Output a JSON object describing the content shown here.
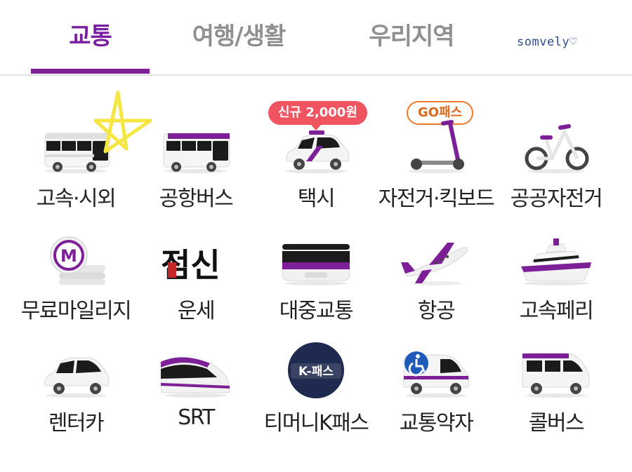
{
  "tabs": [
    {
      "label": "교통",
      "active": true
    },
    {
      "label": "여행/생활",
      "active": false
    },
    {
      "label": "우리지역",
      "active": false
    }
  ],
  "brand_text": "somvely♡",
  "accent_color": "#7b1fa2",
  "items": [
    {
      "label": "고속·시외",
      "icon": "express-bus-icon"
    },
    {
      "label": "공항버스",
      "icon": "airport-bus-icon"
    },
    {
      "label": "택시",
      "icon": "taxi-icon",
      "badge": "신규 2,000원"
    },
    {
      "label": "자전거·킥보드",
      "icon": "kickboard-icon",
      "badge": "GO패스"
    },
    {
      "label": "공공자전거",
      "icon": "bicycle-icon"
    },
    {
      "label": "무료마일리지",
      "icon": "mileage-coin-icon"
    },
    {
      "label": "운세",
      "icon": "fortune-icon",
      "icon_text": "점신"
    },
    {
      "label": "대중교통",
      "icon": "subway-train-icon"
    },
    {
      "label": "항공",
      "icon": "airplane-icon"
    },
    {
      "label": "고속페리",
      "icon": "ferry-icon"
    },
    {
      "label": "렌터카",
      "icon": "rental-car-icon"
    },
    {
      "label": "SRT",
      "icon": "srt-train-icon"
    },
    {
      "label": "티머니K패스",
      "icon": "k-pass-icon",
      "icon_text": "K-패스"
    },
    {
      "label": "교통약자",
      "icon": "accessible-taxi-icon"
    },
    {
      "label": "콜버스",
      "icon": "call-bus-icon"
    }
  ]
}
